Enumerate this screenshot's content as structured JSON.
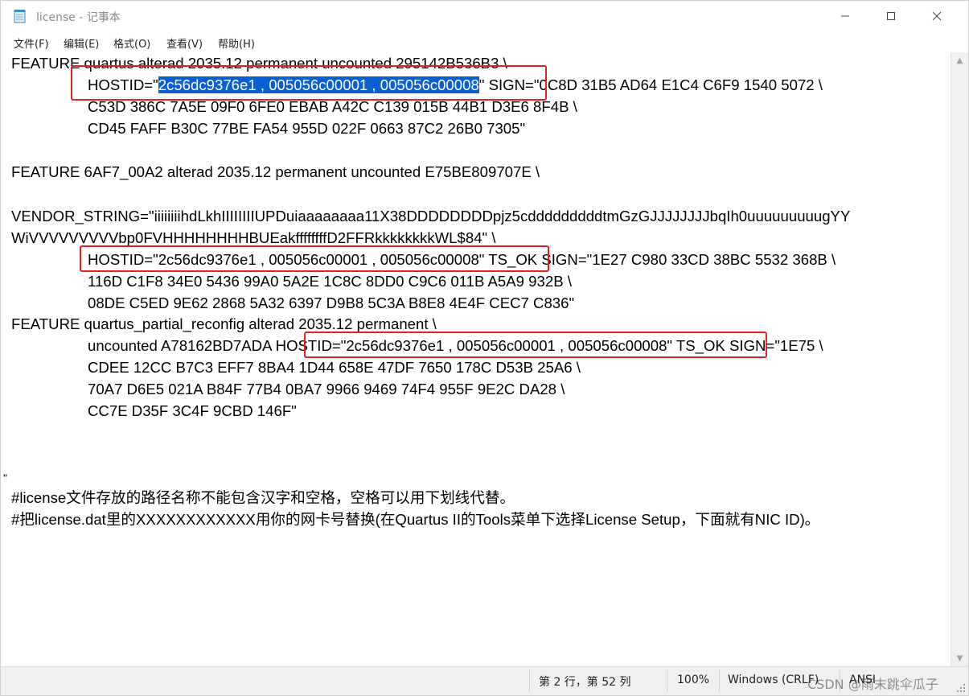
{
  "window": {
    "title": "license - 记事本",
    "controls": {
      "minimize": "minimize",
      "maximize": "maximize",
      "close": "close"
    }
  },
  "menu": [
    "文件(F)",
    "编辑(E)",
    "格式(O)",
    "查看(V)",
    "帮助(H)"
  ],
  "editor": {
    "lines": [
      "FEATURE quartus alterad 2035.12 permanent uncounted 295142B536B3 \\",
      "HOSTID=\"",
      "C53D 386C 7A5E 09F0 6FE0 EBAB A42C C139 015B 44B1 D3E6 8F4B \\",
      "CD45 FAFF B30C 77BE FA54 955D 022F 0663 87C2 26B0 7305\"",
      "FEATURE 6AF7_00A2 alterad 2035.12 permanent uncounted E75BE809707E \\",
      "VENDOR_STRING=\"iiiiiiiihdLkhIIIIIIIIUPDuiaaaaaaaa11X38DDDDDDDDpjz5cdddddddddtmGzGJJJJJJJJbqIh0uuuuuuuuugYY",
      "WiVVVVVVVVVbp0FVHHHHHHHHBUEakffffffffD2FFRkkkkkkkkWL$84\" \\",
      "HOSTID=\"2c56dc9376e1 , 005056c00001 , 005056c00008\" TS_OK SIGN=\"1E27 C980 33CD 38BC 5532 368B \\",
      "116D C1F8 34E0 5436 99A0 5A2E 1C8C 8DD0 C9C6 011B A5A9 932B \\",
      "08DE C5ED 9E62 2868 5A32 6397 D9B8 5C3A B8E8 4E4F CEC7 C836\"",
      "FEATURE quartus_partial_reconfig alterad 2035.12 permanent \\",
      "uncounted A78162BD7ADA HOSTID=\"2c56dc9376e1 , 005056c00001 , 005056c00008\" TS_OK SIGN=\"1E75 \\",
      "CDEE 12CC B7C3 EFF7 8BA4 1D44 658E 47DF 7650 178C D53B 25A6 \\",
      "70A7 D6E5 021A B84F 77B4 0BA7 9966 9469 74F4 955F 9E2C DA28 \\",
      "CC7E D35F 3C4F 9CBD 146F\"",
      "#license文件存放的路径名称不能包含汉字和空格，空格可以用下划线代替。",
      "#把license.dat里的XXXXXXXXXXXX用你的网卡号替换(在Quartus II的Tools菜单下选择License Setup，下面就有NIC ID)。"
    ],
    "selected_text": "2c56dc9376e1 , 005056c00001 , 005056c00008",
    "line2_after_selection": "\" SIGN=\"0C8D 31B5 AD64 E1C4 C6F9 1540 5072 \\",
    "stray_char": "\""
  },
  "status": {
    "position": "第 2 行，第 52 列",
    "zoom": "100%",
    "line_ending": "Windows (CRLF)",
    "encoding": "ANSI",
    "watermark": "CSDN @雨末跳伞瓜子"
  },
  "colors": {
    "selection": "#0a5fd2",
    "highlight_box": "#e22222"
  }
}
